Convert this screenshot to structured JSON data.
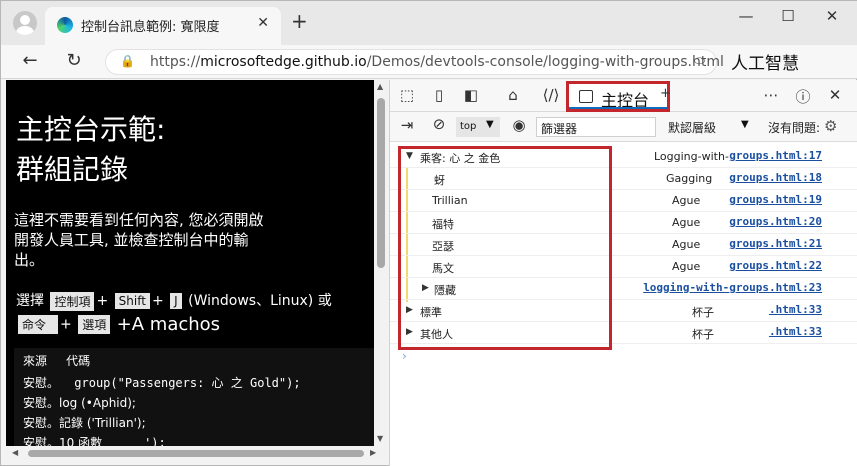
{
  "browser": {
    "tab_title": "控制台訊息範例: 寬限度",
    "tab_close": "✕",
    "new_tab": "+",
    "minimize": "—",
    "maximize": "☐",
    "close": "✕",
    "url_prefix": "https://",
    "url_host": "microsoftedge.github.io",
    "url_path": "/Demos/devtools-console/logging-with-groups.html",
    "ai_label": "人工智慧"
  },
  "page": {
    "heading_line1": "主控台示範:",
    "heading_line2": "群組記錄",
    "description": "這裡不需要看到任何內容, 您必須開啟開發人員工具, 並檢查控制台中的輸出。",
    "shortcut_prefix": "選擇",
    "key_ctrl": "控制項",
    "key_plus1": "+",
    "key_shift": "Shift",
    "key_plus2": "+",
    "key_j": "J",
    "shortcut_platforms": "(Windows、Linux) 或",
    "key_cmd": "命令",
    "key_plus3": "+",
    "key_option": "選項",
    "shortcut_suffix": "+A machos",
    "code_head_source": "來源",
    "code_head_code": "代碼",
    "code_lines": [
      "安慰。",
      "安慰。log (•Aphid);",
      "安慰。記錄 ('Trillian');",
      "安慰。10 函數"
    ],
    "code_line1_rest": "group(\"Passengers: 心     之  Gold\");",
    "code_line4_rest": "');"
  },
  "devtools": {
    "console_tab": "主控台",
    "add_tab": "+",
    "context": "top",
    "filter_placeholder": "篩選器",
    "levels": "默認層級",
    "issues": "沒有問題:",
    "rows": [
      {
        "msg": "乘客:           心       之   金色",
        "src": "Logging-with-",
        "link": "groups.html:17",
        "open": true
      },
      {
        "msg": "蚜",
        "src": "Gagging",
        "link": "groups.html:18"
      },
      {
        "msg": "Trillian",
        "src": "Ague",
        "link": "groups.html:19"
      },
      {
        "msg": "福特",
        "src": "Ague",
        "link": "groups.html:20"
      },
      {
        "msg": "亞瑟",
        "src": "Ague",
        "link": "groups.html:21"
      },
      {
        "msg": "馬文",
        "src": "Ague",
        "link": "groups.html:22"
      },
      {
        "msg": "隱藏",
        "src": "",
        "link": "logging-with-groups.html:23",
        "collapsed": true
      },
      {
        "msg": "標準",
        "src": "杯子",
        "link": ".html:33",
        "collapsed": true
      },
      {
        "msg": "其他人",
        "src": "杯子",
        "link": ".html:33",
        "collapsed": true
      }
    ],
    "prompt": "›"
  }
}
